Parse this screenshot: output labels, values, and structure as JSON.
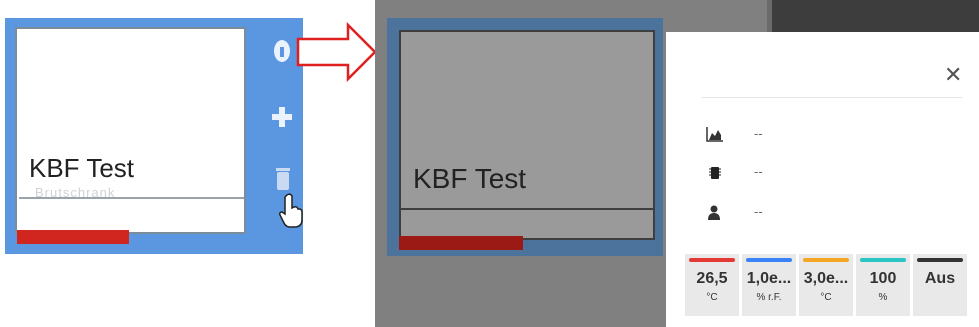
{
  "left_tile": {
    "title": "KBF Test",
    "subtitle": "Brutschrank",
    "side_icons": [
      "info-icon",
      "plus-icon",
      "trash-icon",
      "hand-cursor-icon"
    ]
  },
  "popup": {
    "rows": [
      {
        "icon": "chart-area-icon",
        "value": "--"
      },
      {
        "icon": "chip-icon",
        "value": "--"
      },
      {
        "icon": "user-icon",
        "value": "--"
      }
    ],
    "sensors": [
      {
        "value": "26,5",
        "unit": "°C",
        "color": "#e53935"
      },
      {
        "value": "1,0e...",
        "unit": "% r.F.",
        "color": "#3b82f6"
      },
      {
        "value": "3,0e...",
        "unit": "°C",
        "color": "#f5a623"
      },
      {
        "value": "100",
        "unit": "%",
        "color": "#2bc4c4"
      },
      {
        "value": "Aus",
        "unit": "",
        "color": "#333333"
      }
    ]
  },
  "right_tile": {
    "title": "KBF Test"
  },
  "colors": {
    "tile_blue": "#5b97e0",
    "tile_blue_dim": "#4b739b",
    "alarm_red": "#d0261f",
    "arrow_red": "#e02020"
  }
}
